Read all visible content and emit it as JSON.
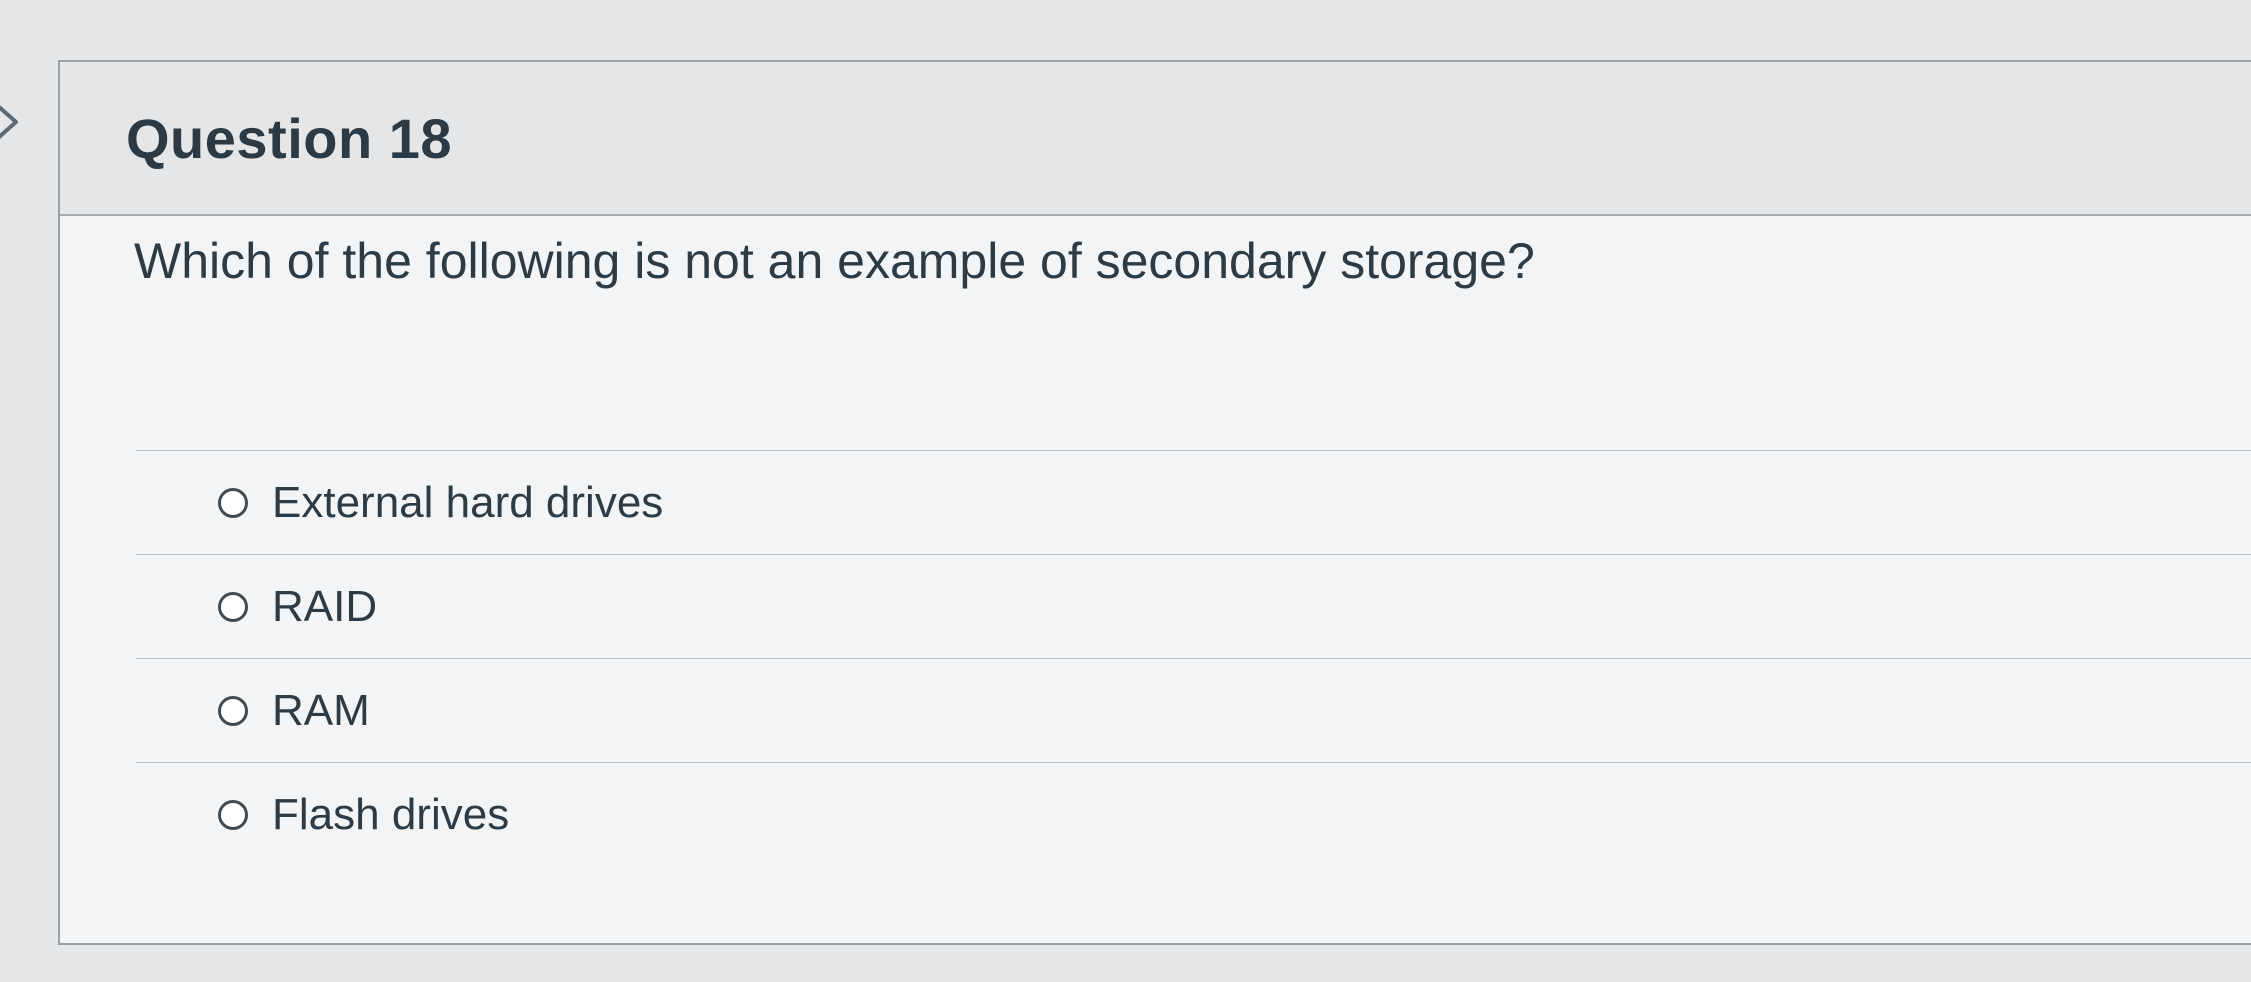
{
  "question": {
    "title": "Question 18",
    "prompt": "Which of the following is not an example of secondary storage?",
    "options": [
      {
        "label": "External hard drives",
        "selected": false
      },
      {
        "label": "RAID",
        "selected": false
      },
      {
        "label": "RAM",
        "selected": false
      },
      {
        "label": "Flash drives",
        "selected": false
      }
    ]
  },
  "icons": {
    "nav": "chevron-right-icon",
    "radio": "radio-unselected-icon"
  },
  "colors": {
    "text": "#2d3b45",
    "border": "#9aa1a6",
    "header_bg": "#e4e6e8",
    "card_bg": "#f3f4f5"
  }
}
